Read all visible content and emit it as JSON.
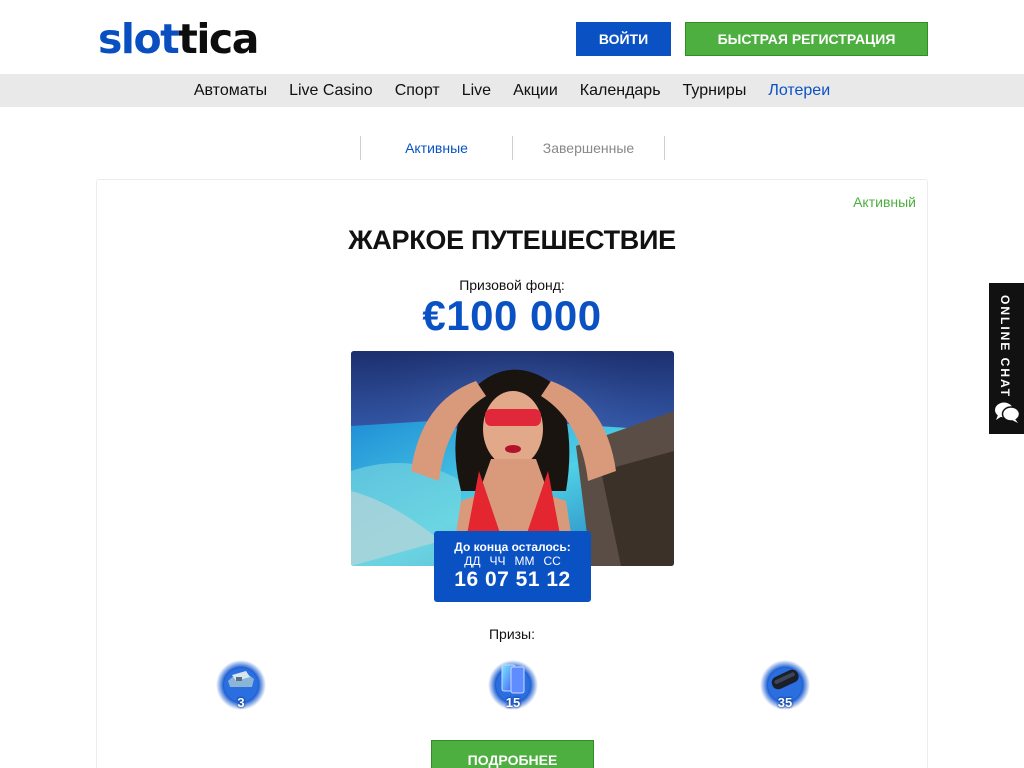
{
  "header": {
    "logo_part1": "slot",
    "logo_part2": "tica",
    "login_label": "ВОЙТИ",
    "register_label": "БЫСТРАЯ РЕГИСТРАЦИЯ"
  },
  "nav": {
    "items": [
      {
        "label": "Автоматы"
      },
      {
        "label": "Live Casino"
      },
      {
        "label": "Спорт"
      },
      {
        "label": "Live"
      },
      {
        "label": "Акции"
      },
      {
        "label": "Календарь"
      },
      {
        "label": "Турниры"
      },
      {
        "label": "Лотереи",
        "active": true
      }
    ]
  },
  "tabs": {
    "active_label": "Активные",
    "finished_label": "Завершенные"
  },
  "lottery": {
    "status": "Активный",
    "title": "ЖАРКОЕ ПУТЕШЕСТВИЕ",
    "fund_label": "Призовой фонд:",
    "fund_amount": "€100 000",
    "timer": {
      "title": "До конца осталось:",
      "units": [
        "ДД",
        "ЧЧ",
        "ММ",
        "СС"
      ],
      "values": "16 07 51 12"
    },
    "prizes_label": "Призы:",
    "prizes": [
      {
        "icon": "trip-icon",
        "count": "3"
      },
      {
        "icon": "phone-icon",
        "count": "15"
      },
      {
        "icon": "speaker-icon",
        "count": "35"
      }
    ],
    "more_label": "ПОДРОБНЕЕ"
  },
  "chat": {
    "label": "ONLINE CHAT",
    "icon": "chat-bubbles-icon"
  },
  "colors": {
    "brand_blue": "#0a52c4",
    "brand_green": "#4caf3f",
    "nav_bg": "#e9e9e9"
  }
}
